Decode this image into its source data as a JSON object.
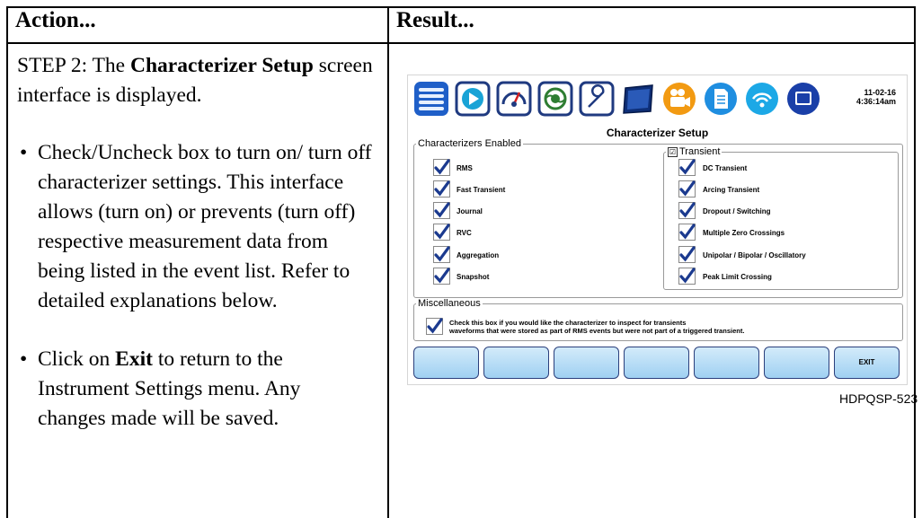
{
  "headers": {
    "action": "Action...",
    "result": "Result..."
  },
  "step": {
    "prefix": "STEP 2: The ",
    "bold": "Characterizer Setup",
    "suffix": " screen interface is displayed."
  },
  "bullets": {
    "symbol": "•",
    "one": "Check/Uncheck box to turn on/ turn off characterizer settings. This interface allows (turn on) or prevents (turn off) respective measurement data from being listed in the event list. Refer to detailed explanations below.",
    "two_prefix": "Click on ",
    "two_bold": "Exit",
    "two_suffix": " to return to the Instrument Settings menu. Any changes made will be saved."
  },
  "screenshot": {
    "icons": [
      "menu-icon",
      "play-icon",
      "meter-icon",
      "scope-icon",
      "wrench-icon",
      "monitor-icon",
      "camera-icon",
      "document-icon",
      "wireless-icon",
      "display-icon"
    ],
    "date": "11-02-16",
    "time": "4:36:14am",
    "title": "Characterizer Setup",
    "enabled_legend": "Characterizers Enabled",
    "enabled_items": [
      "RMS",
      "Fast Transient",
      "Journal",
      "RVC",
      "Aggregation",
      "Snapshot"
    ],
    "transient_legend": "Transient",
    "transient_box": "☑",
    "transient_items": [
      "DC Transient",
      "Arcing Transient",
      "Dropout / Switching",
      "Multiple Zero Crossings",
      "Unipolar / Bipolar / Oscillatory",
      "Peak Limit Crossing"
    ],
    "misc_legend": "Miscellaneous",
    "misc_line1": "Check this box if you would like the characterizer to inspect for transients",
    "misc_line2": "waveforms that were stored as part of RMS events but were not part of a triggered transient.",
    "exit_label": "EXIT"
  },
  "caption": "HDPQSP-523",
  "colors": {
    "check": "#1b3a8f",
    "icon_border": "#1f3a80",
    "softkey_top": "#d3ebfa",
    "softkey_bottom": "#9fd0f2"
  }
}
